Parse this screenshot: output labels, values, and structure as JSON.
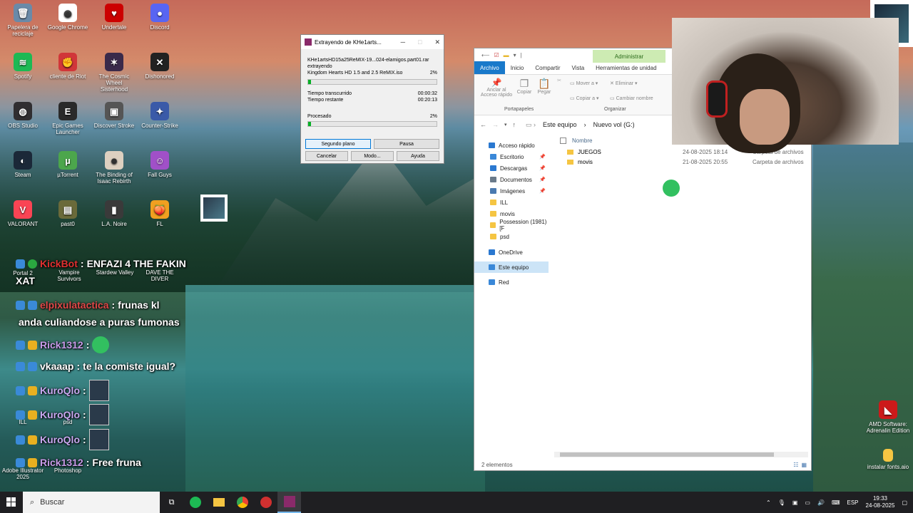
{
  "desktop": {
    "icons": [
      {
        "label": "Papelera de reciclaje",
        "color": "#6a8aa8",
        "glyph": "🗑"
      },
      {
        "label": "Google Chrome",
        "color": "#ffffff",
        "glyph": "◉"
      },
      {
        "label": "Undertale",
        "color": "#cc0000",
        "glyph": "♥"
      },
      {
        "label": "Discord",
        "color": "#5865f2",
        "glyph": "●"
      },
      {
        "label": "Spotify",
        "color": "#1db954",
        "glyph": "≋"
      },
      {
        "label": "cliente de Riot",
        "color": "#d13639",
        "glyph": "✊"
      },
      {
        "label": "The Cosmic Wheel Sisterhood",
        "color": "#3a2a4a",
        "glyph": "✶"
      },
      {
        "label": "Dishonored",
        "color": "#222222",
        "glyph": "✕"
      },
      {
        "label": "OBS Studio",
        "color": "#302e31",
        "glyph": "◍"
      },
      {
        "label": "Epic Games Launcher",
        "color": "#2a2a2a",
        "glyph": "E"
      },
      {
        "label": "Discover Stroke",
        "color": "#555555",
        "glyph": "▣"
      },
      {
        "label": "Counter-Strike",
        "color": "#3a5aa8",
        "glyph": "✦"
      },
      {
        "label": "Steam",
        "color": "#1b2838",
        "glyph": "◐"
      },
      {
        "label": "µTorrent",
        "color": "#4ca64c",
        "glyph": "µ"
      },
      {
        "label": "The Binding of Isaac Rebirth",
        "color": "#ddd0c0",
        "glyph": "☻"
      },
      {
        "label": "Fall Guys",
        "color": "#a050c8",
        "glyph": "☺"
      },
      {
        "label": "VALORANT",
        "color": "#fa4454",
        "glyph": "V"
      },
      {
        "label": "past0",
        "color": "#6a6a3a",
        "glyph": "▤"
      },
      {
        "label": "L.A. Noire",
        "color": "#3a3a3a",
        "glyph": "▮"
      },
      {
        "label": "FL",
        "color": "#f0a020",
        "glyph": "🍑"
      }
    ],
    "extra_icons": [
      {
        "label": "Portal 2"
      },
      {
        "label": "Vampire Survivors"
      },
      {
        "label": "Stardew Valley"
      },
      {
        "label": "DAVE THE DIVER"
      },
      {
        "label": "ILL"
      },
      {
        "label": "psd"
      },
      {
        "label": "Adobe Illustrator 2025"
      },
      {
        "label": "Photoshop"
      },
      {
        "label": "AMD Software: Adrenalin Edition"
      },
      {
        "label": "instalar fonts.aio"
      }
    ]
  },
  "chat": [
    {
      "user": "KickBot",
      "user_color": "#e03030",
      "message": "ENFAZI 4 THE FAKIN",
      "message2": "XAT"
    },
    {
      "user": "elpixulatactica",
      "user_color": "#e04848",
      "message": "frunas kl",
      "message2": "anda culiandose a puras fumonas"
    },
    {
      "user": "Rick1312",
      "user_color": "#c89ae8",
      "message": ""
    },
    {
      "user": "vkaaap",
      "user_color": "#ffffff",
      "message": "te la comiste igual?"
    },
    {
      "user": "KuroQlo",
      "user_color": "#c8a8f0",
      "message": ""
    },
    {
      "user": "KuroQlo",
      "user_color": "#c8a8f0",
      "message": ""
    },
    {
      "user": "KuroQlo",
      "user_color": "#c8a8f0",
      "message": ""
    },
    {
      "user": "Rick1312",
      "user_color": "#c89ae8",
      "message": "Free fruna"
    }
  ],
  "extract_dialog": {
    "title": "Extrayendo de KHe1arts...",
    "archive": "KHe1artsHD15a25ReMIX-19...024-elamigos.part01.rar",
    "action": "extrayendo",
    "file": "Kingdom Hearts HD 1.5 and 2.5 ReMIX.iso",
    "file_pct": "2%",
    "file_progress": 0.02,
    "elapsed_label": "Tiempo transcurrido",
    "elapsed": "00:00:32",
    "remaining_label": "Tiempo restante",
    "remaining": "00:20:13",
    "processed_label": "Procesado",
    "processed_pct": "2%",
    "processed_progress": 0.02,
    "buttons": {
      "background": "Segundo plano",
      "pause": "Pausa",
      "cancel": "Cancelar",
      "mode": "Modo...",
      "help": "Ayuda"
    }
  },
  "explorer": {
    "manage_tab": "Administrar",
    "tabs": [
      "Archivo",
      "Inicio",
      "Compartir",
      "Vista",
      "Herramientas de unidad"
    ],
    "ribbon": {
      "pin": "Anclar al Acceso rápido",
      "copy": "Copiar",
      "paste": "Pegar",
      "move_to": "Mover a",
      "copy_to": "Copiar a",
      "delete": "Eliminar",
      "rename": "Cambiar nombre",
      "group_clipboard": "Portapapeles",
      "group_organize": "Organizar"
    },
    "address": [
      "Este equipo",
      "Nuevo vol (G:)"
    ],
    "nav": [
      {
        "label": "Acceso rápido",
        "icon": "star",
        "color": "#2a78d0",
        "pinned": false
      },
      {
        "label": "Escritorio",
        "icon": "desktop",
        "color": "#3a88d8",
        "pinned": true
      },
      {
        "label": "Descargas",
        "icon": "download",
        "color": "#2a78d0",
        "pinned": true
      },
      {
        "label": "Documentos",
        "icon": "documents",
        "color": "#6a7a8a",
        "pinned": true
      },
      {
        "label": "Imágenes",
        "icon": "images",
        "color": "#4a7ab0",
        "pinned": true
      },
      {
        "label": "ILL",
        "icon": "folder",
        "color": "#f5c542",
        "pinned": false
      },
      {
        "label": "movis",
        "icon": "folder",
        "color": "#f5c542",
        "pinned": false
      },
      {
        "label": "Possession (1981) [F",
        "icon": "folder",
        "color": "#f5c542",
        "pinned": false
      },
      {
        "label": "psd",
        "icon": "folder",
        "color": "#f5c542",
        "pinned": false
      },
      {
        "label": "OneDrive",
        "icon": "cloud",
        "color": "#2a78d0",
        "pinned": false
      },
      {
        "label": "Este equipo",
        "icon": "computer",
        "color": "#3a88d8",
        "pinned": false
      },
      {
        "label": "Red",
        "icon": "network",
        "color": "#3a88d8",
        "pinned": false
      }
    ],
    "column_name": "Nombre",
    "files": [
      {
        "name": "JUEGOS",
        "date": "24-08-2025 18:14",
        "type": "Carpeta de archivos"
      },
      {
        "name": "movis",
        "date": "21-08-2025 20:55",
        "type": "Carpeta de archivos"
      }
    ],
    "status": "2 elementos"
  },
  "taskbar": {
    "search_placeholder": "Buscar",
    "language": "ESP",
    "time": "19:33",
    "date": "24-08-2025"
  }
}
